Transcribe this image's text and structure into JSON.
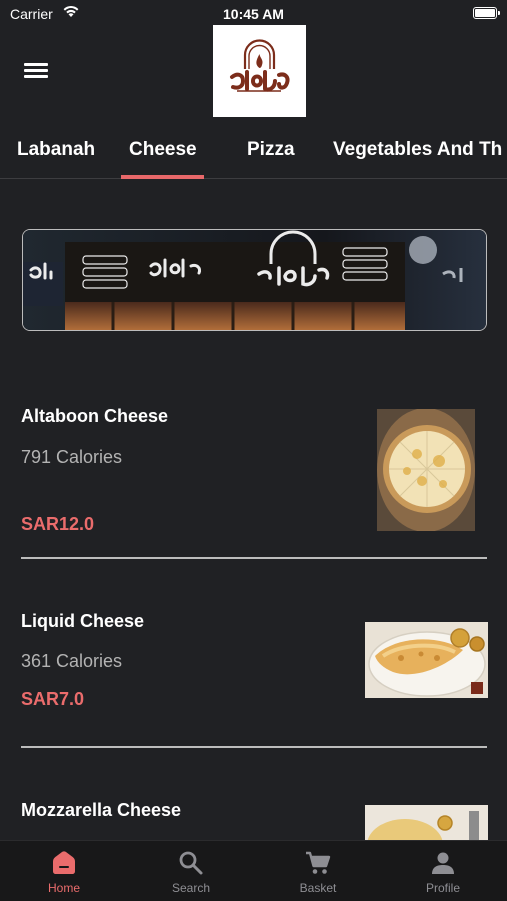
{
  "status_bar": {
    "carrier": "Carrier",
    "time": "10:45 AM"
  },
  "header": {
    "logo_icon": "altaboon-logo-icon",
    "menu_icon": "hamburger-menu-icon"
  },
  "tabs": [
    {
      "label": "Labanah"
    },
    {
      "label": "Cheese"
    },
    {
      "label": "Pizza"
    },
    {
      "label": "Vegetables And Th"
    }
  ],
  "selected_tab": "Cheese",
  "menu_items": [
    {
      "name": "Altaboon Cheese",
      "calories": "791 Calories",
      "price": "SAR12.0"
    },
    {
      "name": "Liquid Cheese",
      "calories": "361 Calories",
      "price": "SAR7.0"
    },
    {
      "name": "Mozzarella Cheese"
    }
  ],
  "bottom_nav": [
    {
      "label": "Home",
      "icon": "home-icon"
    },
    {
      "label": "Search",
      "icon": "search-icon"
    },
    {
      "label": "Basket",
      "icon": "cart-icon"
    },
    {
      "label": "Profile",
      "icon": "profile-icon"
    }
  ],
  "colors": {
    "accent": "#ea6c6c",
    "background": "#202124",
    "tab_bar": "#181819",
    "muted_text": "#b3b3b3"
  }
}
